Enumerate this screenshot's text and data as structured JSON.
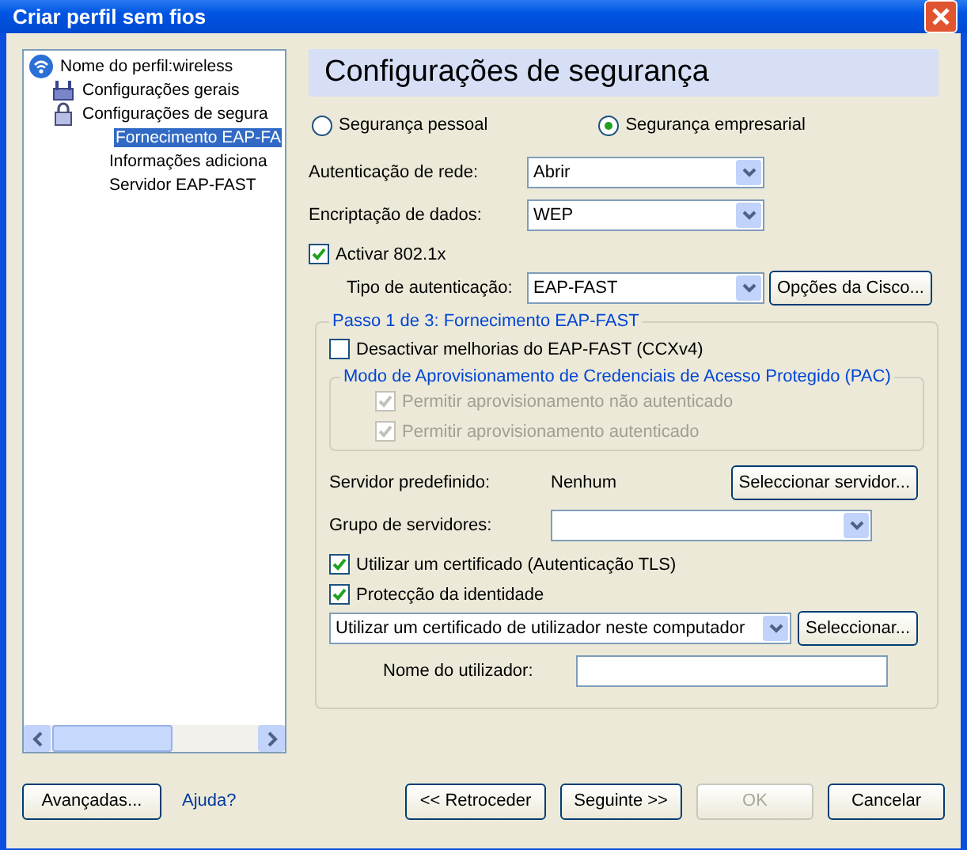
{
  "window": {
    "title": "Criar perfil sem fios"
  },
  "tree": [
    {
      "label": "Nome do perfil:wireless",
      "selected": false,
      "children": [
        {
          "label": "Configurações gerais",
          "selected": false
        },
        {
          "label": "Configurações de segura",
          "selected": false,
          "children": [
            {
              "label": "Fornecimento EAP-FA",
              "selected": true
            },
            {
              "label": "Informações adiciona",
              "selected": false
            },
            {
              "label": "Servidor EAP-FAST",
              "selected": false
            }
          ]
        }
      ]
    }
  ],
  "header": "Configurações de segurança",
  "security_modes": [
    {
      "label": "Segurança pessoal",
      "selected": false
    },
    {
      "label": "Segurança empresarial",
      "selected": true
    }
  ],
  "network_auth": {
    "label": "Autenticação de rede:",
    "value": "Abrir"
  },
  "data_encryption": {
    "label": "Encriptação de dados:",
    "value": "WEP"
  },
  "enable_8021x": {
    "label": "Activar 802.1x",
    "checked": true
  },
  "auth_type": {
    "label": "Tipo de autenticação:",
    "value": "EAP-FAST",
    "button": "Opções da Cisco..."
  },
  "step_group": {
    "title": "Passo 1 de 3: Fornecimento EAP-FAST",
    "disable_enhancements": {
      "label": "Desactivar melhorias do EAP-FAST (CCXv4)",
      "checked": false
    },
    "pac_group": {
      "title": "Modo de Aprovisionamento de Credenciais de Acesso Protegido (PAC)",
      "options": [
        {
          "label": "Permitir aprovisionamento não autenticado",
          "checked": true,
          "disabled": true
        },
        {
          "label": "Permitir aprovisionamento autenticado",
          "checked": true,
          "disabled": true
        }
      ]
    },
    "default_server": {
      "label": "Servidor predefinido:",
      "value": "Nenhum",
      "button": "Seleccionar servidor..."
    },
    "server_group": {
      "label": "Grupo de servidores:"
    },
    "options": [
      {
        "label": "Utilizar um certificado (Autenticação TLS)",
        "checked": true
      },
      {
        "label": "Protecção da identidade",
        "checked": true
      }
    ],
    "certificate": {
      "value": "Utilizar um certificado de utilizador neste computador",
      "button": "Seleccionar..."
    },
    "username": {
      "label": "Nome do utilizador:"
    }
  },
  "footer": {
    "advanced": "Avançadas...",
    "help": "Ajuda?",
    "buttons": [
      {
        "label": "<< Retroceder",
        "disabled": false
      },
      {
        "label": "Seguinte >>",
        "disabled": false
      },
      {
        "label": "OK",
        "disabled": true
      },
      {
        "label": "Cancelar",
        "disabled": false
      }
    ]
  }
}
